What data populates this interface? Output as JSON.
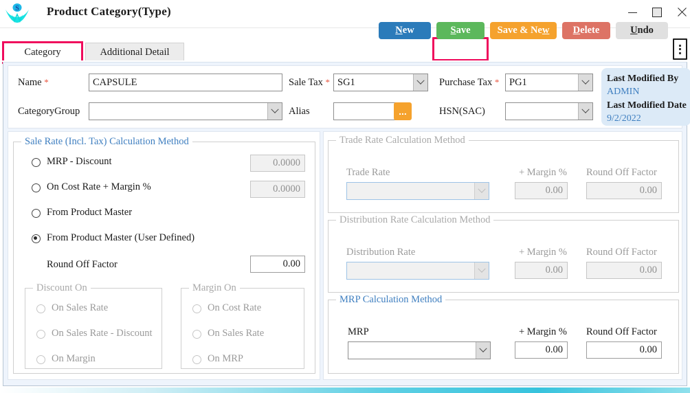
{
  "window": {
    "title": "Product Category(Type)",
    "logo_icon": "company-logo-icon",
    "minimize_icon": "minimize-icon",
    "maximize_icon": "maximize-icon",
    "close_icon": "close-icon"
  },
  "toolbar": {
    "new_label": "New",
    "new_accel": "N",
    "save_label": "Save",
    "save_accel": "S",
    "save_new_label": "Save & New",
    "save_new_accel": "w",
    "delete_label": "Delete",
    "delete_accel": "D",
    "undo_label": "Undo",
    "undo_accel": "U",
    "overflow_icon": "kebab-menu-icon",
    "colors": {
      "new": "#2b7bba",
      "save": "#5cb85c",
      "save_new": "#f5a22d",
      "delete": "#dd7365",
      "undo": "#e0e0e0",
      "highlight": "#ef0b5c"
    }
  },
  "tabs": [
    {
      "label": "Category",
      "active": true
    },
    {
      "label": "Additional Detail",
      "active": false
    }
  ],
  "form": {
    "name_label": "Name",
    "name_required": "*",
    "name_value": "CAPSULE",
    "category_group_label": "CategoryGroup",
    "category_group_value": "",
    "sale_tax_label": "Sale Tax",
    "sale_tax_required": "*",
    "sale_tax_value": "SG1",
    "alias_label": "Alias",
    "alias_value": "",
    "alias_browse_label": "...",
    "purchase_tax_label": "Purchase Tax",
    "purchase_tax_required": "*",
    "purchase_tax_value": "PG1",
    "hsn_label": "HSN(SAC)",
    "hsn_value": ""
  },
  "last_modified": {
    "by_label": "Last Modified By",
    "by_value": "ADMIN",
    "date_label": "Last Modified Date",
    "date_value": "9/2/2022",
    "background": "#dceaf7",
    "value_color": "#3f7fc0"
  },
  "sale_rate": {
    "legend": "Sale Rate (Incl. Tax) Calculation Method",
    "options": [
      {
        "label": "MRP - Discount",
        "checked": false,
        "value": "0.0000",
        "value_disabled": true
      },
      {
        "label": "On Cost Rate + Margin %",
        "checked": false,
        "value": "0.0000",
        "value_disabled": true
      },
      {
        "label": "From Product Master",
        "checked": false
      },
      {
        "label": "From Product Master (User Defined)",
        "checked": true
      }
    ],
    "round_off_label": "Round Off Factor",
    "round_off_value": "0.00",
    "discount_on": {
      "legend": "Discount On",
      "disabled": true,
      "options": [
        {
          "label": "On Sales Rate",
          "checked": false
        },
        {
          "label": "On Sales Rate - Discount",
          "checked": false
        },
        {
          "label": "On Margin",
          "checked": false
        }
      ]
    },
    "margin_on": {
      "legend": "Margin On",
      "disabled": true,
      "options": [
        {
          "label": "On Cost Rate",
          "checked": false
        },
        {
          "label": "On Sales Rate",
          "checked": false
        },
        {
          "label": "On MRP",
          "checked": false
        }
      ]
    }
  },
  "trade_rate": {
    "legend": "Trade Rate Calculation Method",
    "disabled": true,
    "rate_label": "Trade Rate",
    "rate_value": "",
    "margin_label": "+ Margin %",
    "margin_value": "0.00",
    "round_off_label": "Round Off Factor",
    "round_off_value": "0.00"
  },
  "distribution_rate": {
    "legend": "Distribution Rate Calculation Method",
    "disabled": true,
    "rate_label": "Distribution Rate",
    "rate_value": "",
    "margin_label": "+ Margin %",
    "margin_value": "0.00",
    "round_off_label": "Round Off Factor",
    "round_off_value": "0.00"
  },
  "mrp": {
    "legend": "MRP Calculation Method",
    "disabled": false,
    "rate_label": "MRP",
    "rate_value": "",
    "margin_label": "+ Margin %",
    "margin_value": "0.00",
    "round_off_label": "Round Off Factor",
    "round_off_value": "0.00"
  }
}
